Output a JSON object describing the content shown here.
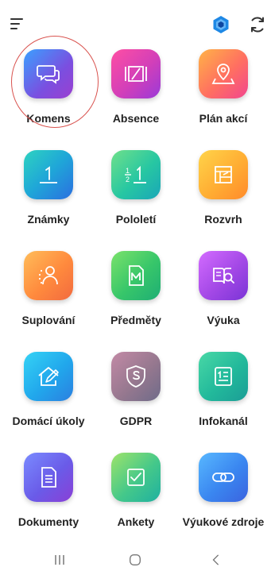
{
  "header": {
    "menu_icon": "hamburger-menu-icon",
    "brand_icon": "brand-shield-icon",
    "refresh_icon": "refresh-icon",
    "accent_color": "#1e88e5"
  },
  "tiles": [
    {
      "label": "Komens",
      "icon": "chat-bubbles-icon"
    },
    {
      "label": "Absence",
      "icon": "absence-icon"
    },
    {
      "label": "Plán akcí",
      "icon": "map-pin-icon"
    },
    {
      "label": "Známky",
      "icon": "grade-one-icon"
    },
    {
      "label": "Pololetí",
      "icon": "fraction-icon"
    },
    {
      "label": "Rozvrh",
      "icon": "timetable-icon"
    },
    {
      "label": "Suplování",
      "icon": "substitute-person-icon"
    },
    {
      "label": "Předměty",
      "icon": "subject-m-icon"
    },
    {
      "label": "Výuka",
      "icon": "book-search-icon"
    },
    {
      "label": "Domácí úkoly",
      "icon": "home-pencil-icon"
    },
    {
      "label": "GDPR",
      "icon": "gdpr-shield-icon"
    },
    {
      "label": "Infokanál",
      "icon": "info-list-icon"
    },
    {
      "label": "Dokumenty",
      "icon": "document-icon"
    },
    {
      "label": "Ankety",
      "icon": "checkbox-icon"
    },
    {
      "label": "Výukové zdroje",
      "icon": "link-icon"
    }
  ],
  "highlight": {
    "target": "Komens",
    "color": "#d9534f"
  },
  "navbar": {
    "recents_icon": "recents-icon",
    "home_icon": "home-icon",
    "back_icon": "back-icon"
  }
}
